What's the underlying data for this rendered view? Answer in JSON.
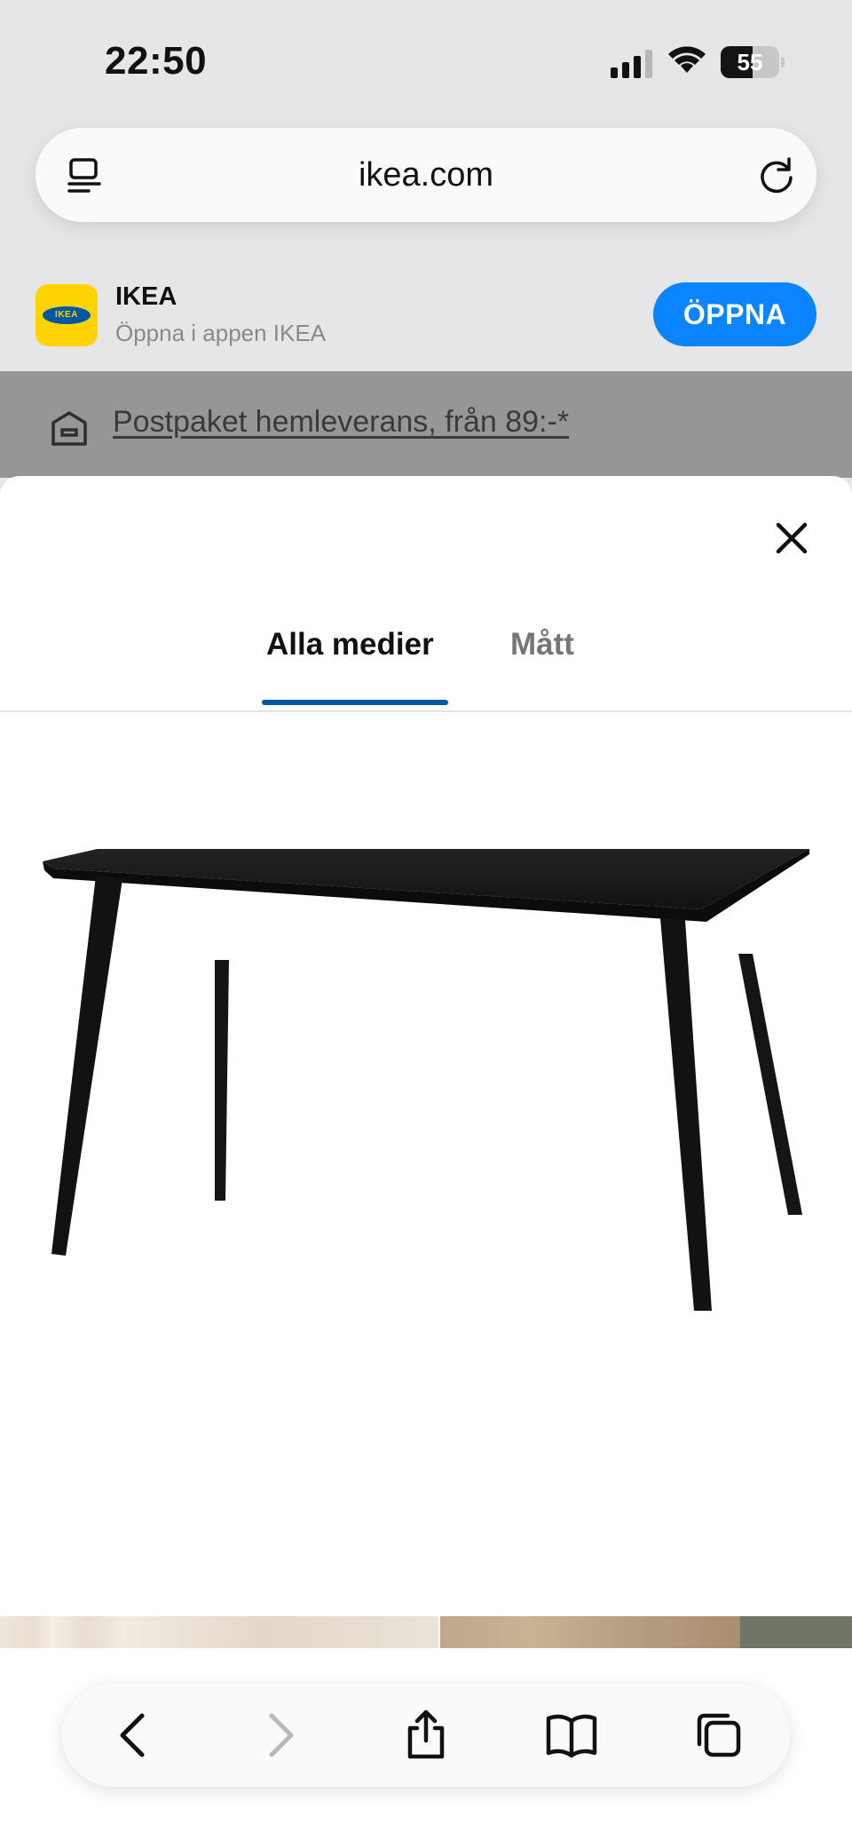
{
  "status_bar": {
    "time": "22:50",
    "battery_level": "55",
    "battery_fraction": 0.55,
    "icons": [
      "signal-icon",
      "wifi-icon",
      "battery-icon"
    ]
  },
  "browser": {
    "url": "ikea.com",
    "icons": [
      "reader-icon",
      "reload-icon"
    ]
  },
  "app_banner": {
    "name": "IKEA",
    "subtitle": "Öppna i appen IKEA",
    "open_label": "ÖPPNA",
    "icon_text": "IKEA"
  },
  "promo": {
    "text": "Postpaket hemleverans, från 89:-*",
    "icon": "delivery-box-icon"
  },
  "media_viewer": {
    "tabs": [
      {
        "label": "Alla medier",
        "active": true
      },
      {
        "label": "Mått",
        "active": false
      }
    ],
    "image_alt": "black table"
  },
  "toolbar": {
    "items": [
      "back-icon",
      "forward-icon",
      "share-icon",
      "bookmarks-icon",
      "tabs-icon"
    ]
  },
  "colors": {
    "accent_blue": "#0058a3",
    "ios_blue": "#0a84ff",
    "ikea_yellow": "#ffd400",
    "promo_gray": "#969696"
  }
}
